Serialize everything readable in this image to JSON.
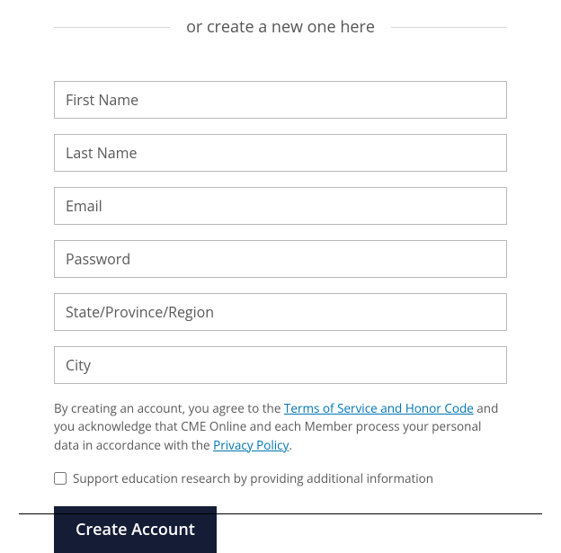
{
  "header": {
    "divider_text": "or create a new one here"
  },
  "form": {
    "first_name_placeholder": "First Name",
    "last_name_placeholder": "Last Name",
    "email_placeholder": "Email",
    "password_placeholder": "Password",
    "state_placeholder": "State/Province/Region",
    "city_placeholder": "City"
  },
  "agreement": {
    "prefix": "By creating an account, you agree to the ",
    "tos_link": "Terms of Service and Honor Code",
    "middle": " and you acknowledge that CME Online and each Member process your personal data in accordance with the ",
    "privacy_link": "Privacy Policy",
    "suffix": "."
  },
  "checkbox": {
    "label": "Support education research by providing additional information"
  },
  "button": {
    "create_label": "Create Account"
  }
}
